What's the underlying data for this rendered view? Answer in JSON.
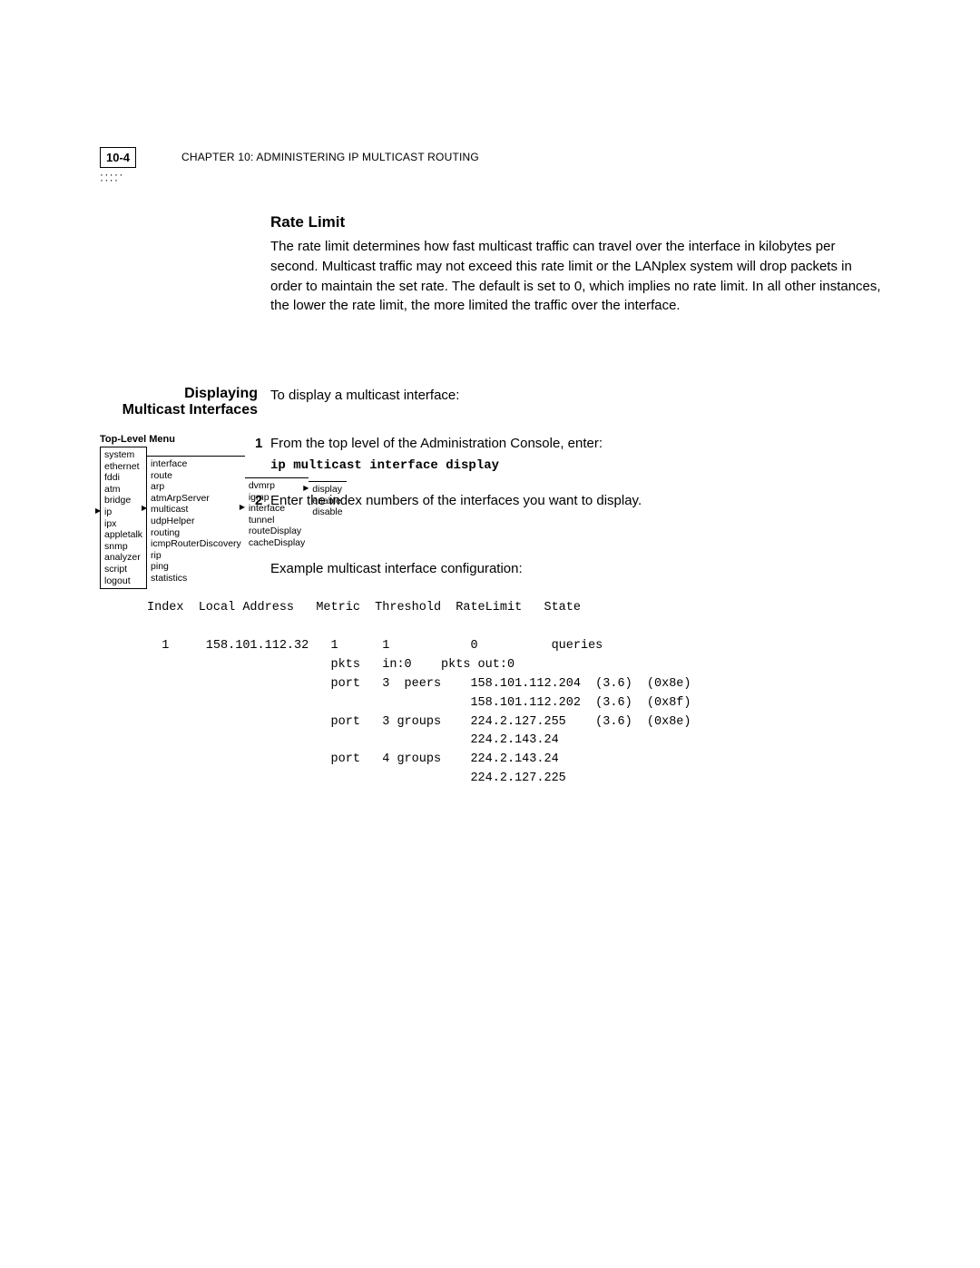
{
  "header": {
    "page_label": "10-4",
    "chapter_line": "CHAPTER 10: ADMINISTERING IP MULTICAST ROUTING"
  },
  "rate_limit": {
    "title": "Rate Limit",
    "para": "The rate limit determines how fast multicast traffic can travel over the interface in kilobytes per second. Multicast traffic may not exceed this rate limit or the LANplex system will drop packets in order to maintain the set rate. The default is set to 0, which implies no rate limit. In all other instances, the lower the rate limit, the more limited the traffic over the interface."
  },
  "displaying": {
    "side_heading_1": "Displaying",
    "side_heading_2": "Multicast Interfaces",
    "intro": "To display a multicast interface:",
    "step1_num": "1",
    "step1_text": "From the top level of the Administration Console, enter:",
    "step1_cmd": "ip multicast interface display",
    "step2_num": "2",
    "step2_text": "Enter the index numbers of the interfaces you want to display.",
    "example_line": "Example multicast interface configuration:"
  },
  "menu": {
    "title": "Top-Level Menu",
    "col1": [
      "system",
      "ethernet",
      "fddi",
      "atm",
      "bridge",
      "ip",
      "ipx",
      "appletalk",
      "snmp",
      "analyzer",
      "script",
      "logout"
    ],
    "col2": [
      "interface",
      "route",
      "arp",
      "atmArpServer",
      "multicast",
      "udpHelper",
      "routing",
      "icmpRouterDiscovery",
      "rip",
      "ping",
      "statistics"
    ],
    "col3": [
      "dvmrp",
      "igmp",
      "interface",
      "tunnel",
      "routeDisplay",
      "cacheDisplay"
    ],
    "col4": [
      "display",
      "enable",
      "disable"
    ]
  },
  "output": "Index  Local Address   Metric  Threshold  RateLimit   State\n\n  1     158.101.112.32   1      1           0          queries\n                         pkts   in:0    pkts out:0\n                         port   3  peers    158.101.112.204  (3.6)  (0x8e)\n                                            158.101.112.202  (3.6)  (0x8f)\n                         port   3 groups    224.2.127.255    (3.6)  (0x8e)\n                                            224.2.143.24\n                         port   4 groups    224.2.143.24\n                                            224.2.127.225"
}
